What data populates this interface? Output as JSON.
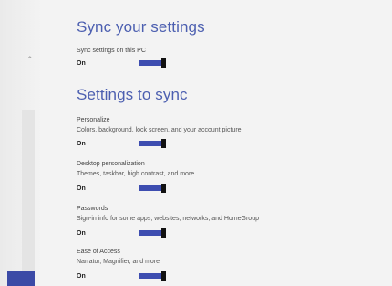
{
  "sync_section": {
    "heading": "Sync your settings",
    "toggle_label": "Sync settings on this PC",
    "toggle_state": "On"
  },
  "settings_section": {
    "heading": "Settings to sync",
    "items": [
      {
        "label": "Personalize",
        "description": "Colors, background, lock screen, and your account picture",
        "state": "On"
      },
      {
        "label": "Desktop personalization",
        "description": "Themes, taskbar, high contrast, and more",
        "state": "On"
      },
      {
        "label": "Passwords",
        "description": "Sign-in info for some apps, websites, networks, and HomeGroup",
        "state": "On"
      },
      {
        "label": "Ease of Access",
        "description": "Narrator, Magnifier, and more",
        "state": "On"
      }
    ]
  },
  "colors": {
    "heading": "#4c5fb0",
    "toggle_on": "#3d4db0",
    "background": "#f3f3f3"
  },
  "scrollbar": {
    "up_icon": "chevron-up-icon"
  }
}
